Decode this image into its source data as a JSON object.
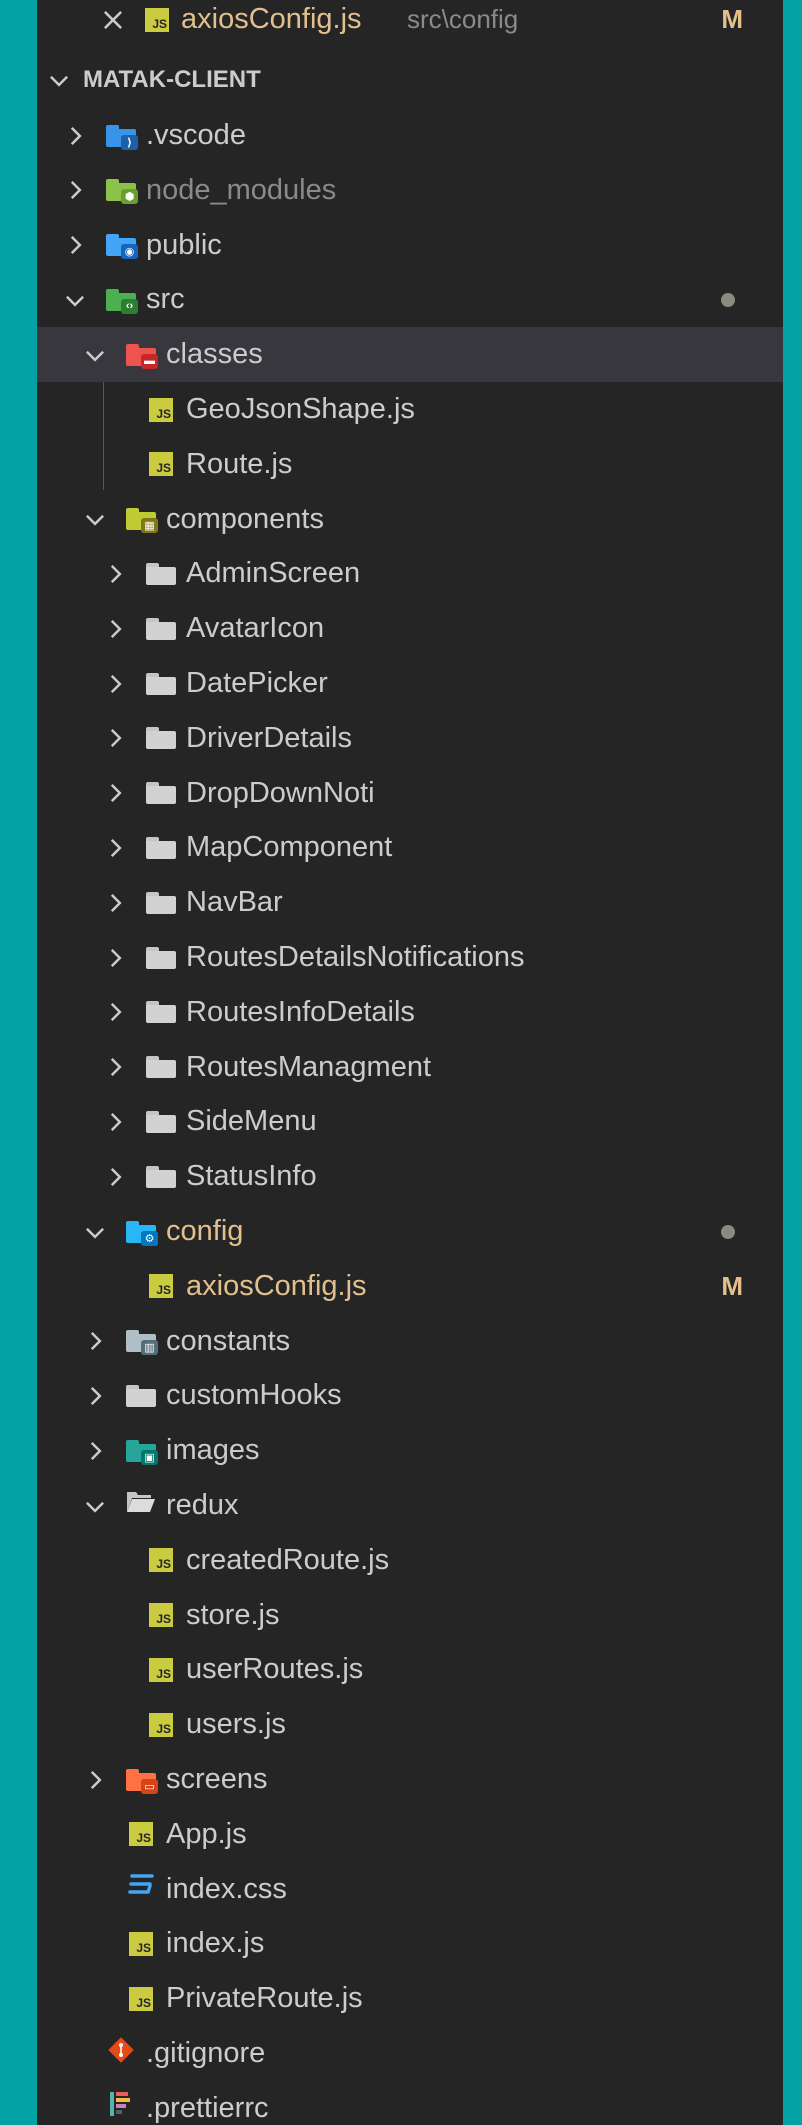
{
  "open_editor": {
    "name": "axiosConfig.js",
    "path": "src\\config",
    "badge": "M"
  },
  "explorer": {
    "root_title": "MATAK-CLIENT"
  },
  "rows": [
    {
      "label": ".vscode",
      "icon": "vscode-folder-icon",
      "chevron": "right",
      "depth": 0
    },
    {
      "label": "node_modules",
      "icon": "node-folder-icon",
      "chevron": "right",
      "depth": 0,
      "dimmed": true
    },
    {
      "label": "public",
      "icon": "public-folder-icon",
      "chevron": "right",
      "depth": 0
    },
    {
      "label": "src",
      "icon": "src-folder-icon",
      "chevron": "down",
      "depth": 0,
      "dot": true
    },
    {
      "label": "classes",
      "icon": "classes-folder-icon",
      "chevron": "down",
      "depth": 1,
      "selected": true
    },
    {
      "label": "GeoJsonShape.js",
      "icon": "js-file-icon",
      "depth": 2
    },
    {
      "label": "Route.js",
      "icon": "js-file-icon",
      "depth": 2
    },
    {
      "label": "components",
      "icon": "components-folder-icon",
      "chevron": "down",
      "depth": 1
    },
    {
      "label": "AdminScreen",
      "icon": "folder-icon",
      "chevron": "right",
      "depth": 2
    },
    {
      "label": "AvatarIcon",
      "icon": "folder-icon",
      "chevron": "right",
      "depth": 2
    },
    {
      "label": "DatePicker",
      "icon": "folder-icon",
      "chevron": "right",
      "depth": 2
    },
    {
      "label": "DriverDetails",
      "icon": "folder-icon",
      "chevron": "right",
      "depth": 2
    },
    {
      "label": "DropDownNoti",
      "icon": "folder-icon",
      "chevron": "right",
      "depth": 2
    },
    {
      "label": "MapComponent",
      "icon": "folder-icon",
      "chevron": "right",
      "depth": 2
    },
    {
      "label": "NavBar",
      "icon": "folder-icon",
      "chevron": "right",
      "depth": 2
    },
    {
      "label": "RoutesDetailsNotifications",
      "icon": "folder-icon",
      "chevron": "right",
      "depth": 2
    },
    {
      "label": "RoutesInfoDetails",
      "icon": "folder-icon",
      "chevron": "right",
      "depth": 2
    },
    {
      "label": "RoutesManagment",
      "icon": "folder-icon",
      "chevron": "right",
      "depth": 2
    },
    {
      "label": "SideMenu",
      "icon": "folder-icon",
      "chevron": "right",
      "depth": 2
    },
    {
      "label": "StatusInfo",
      "icon": "folder-icon",
      "chevron": "right",
      "depth": 2
    },
    {
      "label": "config",
      "icon": "config-folder-icon",
      "chevron": "down",
      "depth": 1,
      "dot": true,
      "modified": true
    },
    {
      "label": "axiosConfig.js",
      "icon": "js-file-icon",
      "depth": 2,
      "badge": "M",
      "modified": true
    },
    {
      "label": "constants",
      "icon": "constants-folder-icon",
      "chevron": "right",
      "depth": 1
    },
    {
      "label": "customHooks",
      "icon": "folder-icon",
      "chevron": "right",
      "depth": 1
    },
    {
      "label": "images",
      "icon": "images-folder-icon",
      "chevron": "right",
      "depth": 1
    },
    {
      "label": "redux",
      "icon": "open-folder-icon",
      "chevron": "down",
      "depth": 1
    },
    {
      "label": "createdRoute.js",
      "icon": "js-file-icon",
      "depth": 2
    },
    {
      "label": "store.js",
      "icon": "js-file-icon",
      "depth": 2
    },
    {
      "label": "userRoutes.js",
      "icon": "js-file-icon",
      "depth": 2
    },
    {
      "label": "users.js",
      "icon": "js-file-icon",
      "depth": 2
    },
    {
      "label": "screens",
      "icon": "screens-folder-icon",
      "chevron": "right",
      "depth": 1
    },
    {
      "label": "App.js",
      "icon": "js-file-icon",
      "depth": 1
    },
    {
      "label": "index.css",
      "icon": "css-file-icon",
      "depth": 1
    },
    {
      "label": "index.js",
      "icon": "js-file-icon",
      "depth": 1
    },
    {
      "label": "PrivateRoute.js",
      "icon": "js-file-icon",
      "depth": 1
    },
    {
      "label": ".gitignore",
      "icon": "git-file-icon",
      "depth": 0
    },
    {
      "label": ".prettierrc",
      "icon": "prettier-file-icon",
      "depth": 0
    }
  ]
}
